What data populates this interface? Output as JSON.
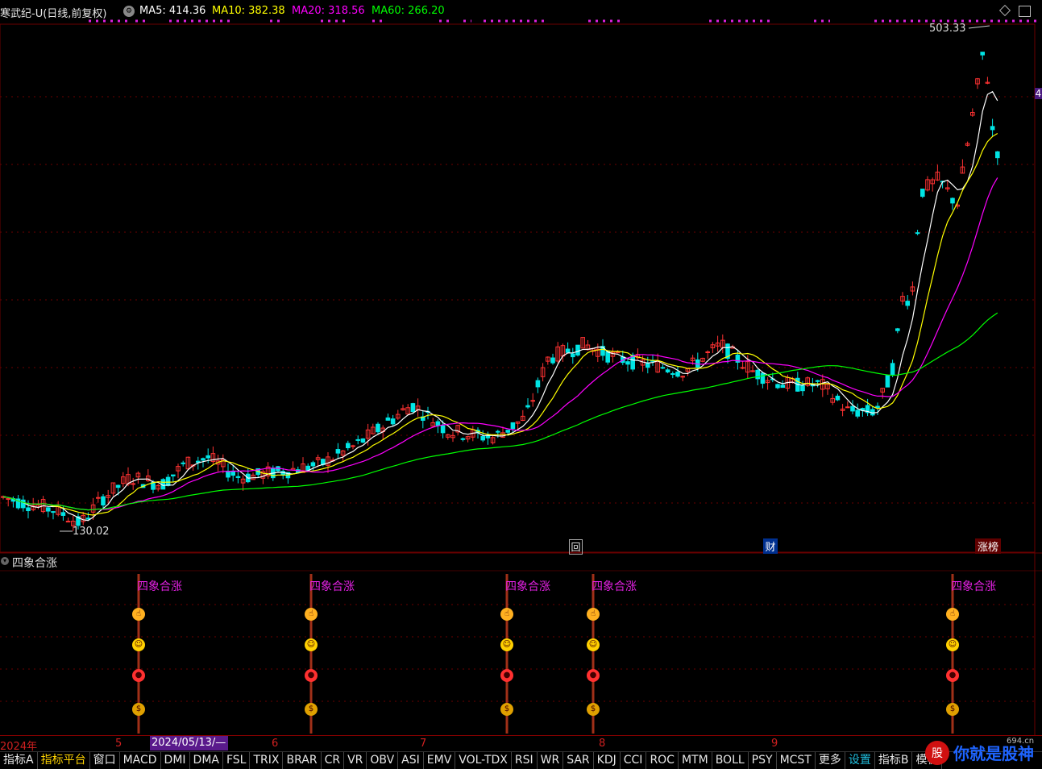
{
  "header": {
    "title": "寒武纪-U(日线,前复权)",
    "ma": [
      {
        "label": "MA5: 414.36",
        "color": "#ffffff"
      },
      {
        "label": "MA10: 382.38",
        "color": "#ffff00"
      },
      {
        "label": "MA20: 318.56",
        "color": "#ff00ff"
      },
      {
        "label": "MA60: 266.20",
        "color": "#00ff00"
      }
    ],
    "icons": [
      "gear-icon",
      "diamond-icon",
      "window-icon"
    ]
  },
  "price_labels": {
    "high": "503.33",
    "low": "130.02",
    "right_tag": "4"
  },
  "event_badges": [
    "回",
    "财",
    "涨榜"
  ],
  "indicator": {
    "name": "四象合涨",
    "signal_text": "四象合涨",
    "icons": [
      "pointing-hand-icon",
      "smiley-icon",
      "candy-icon",
      "money-bag-icon"
    ]
  },
  "date_axis": {
    "labels": [
      "2024年",
      "5",
      "6",
      "7",
      "8",
      "9"
    ],
    "cursor": "2024/05/13/—"
  },
  "tabs": [
    "指标A",
    "指标平台",
    "窗口",
    "MACD",
    "DMI",
    "DMA",
    "FSL",
    "TRIX",
    "BRAR",
    "CR",
    "VR",
    "OBV",
    "ASI",
    "EMV",
    "VOL-TDX",
    "RSI",
    "WR",
    "SAR",
    "KDJ",
    "CCI",
    "ROC",
    "MTM",
    "BOLL",
    "PSY",
    "MCST",
    "更多",
    "设置",
    "指标B",
    "模板"
  ],
  "watermark": {
    "text": "你就是股神",
    "url": "694.cn"
  },
  "colors": {
    "up": "#ff3232",
    "down": "#00e5e5",
    "ma5": "#ffffff",
    "ma10": "#ffff00",
    "ma20": "#ff00ff",
    "ma60": "#00ff00",
    "grid": "#6b0000"
  },
  "chart_data": {
    "type": "candlestick",
    "title": "寒武纪-U(日线,前复权)",
    "ylim": [
      110,
      520
    ],
    "high": 503.33,
    "low": 130.02,
    "moving_averages": {
      "MA5": 414.36,
      "MA10": 382.38,
      "MA20": 318.56,
      "MA60": 266.2
    },
    "note_months": [
      "5",
      "6",
      "7",
      "8",
      "9"
    ]
  }
}
